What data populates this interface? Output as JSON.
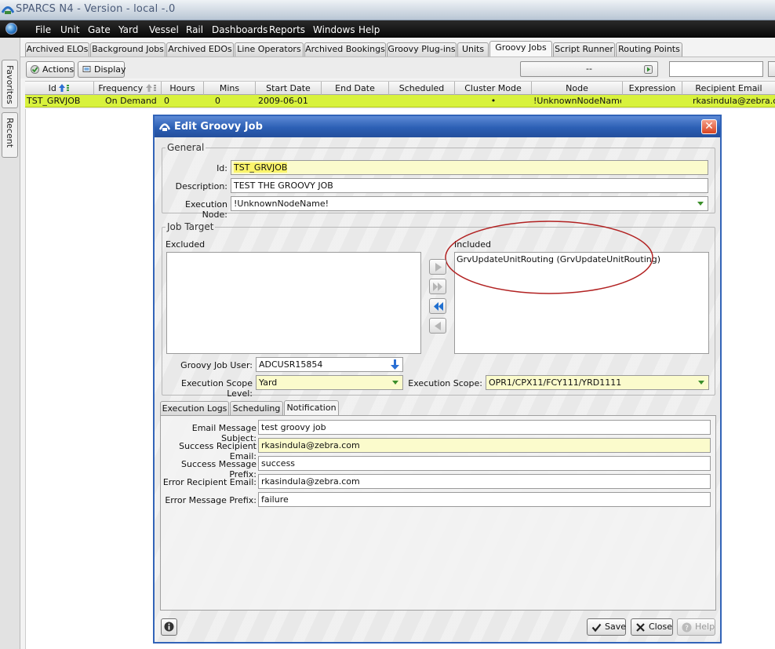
{
  "window": {
    "title": "SPARCS N4 - Version - local -.0"
  },
  "menu": [
    {
      "label": "File"
    },
    {
      "label": "Unit"
    },
    {
      "label": "Gate"
    },
    {
      "label": "Yard"
    },
    {
      "label": "Vessel"
    },
    {
      "label": "Rail"
    },
    {
      "label": "Dashboards"
    },
    {
      "label": "Reports"
    },
    {
      "label": "Windows"
    },
    {
      "label": "Help"
    }
  ],
  "dock": {
    "favorites": "Favorites",
    "recent": "Recent"
  },
  "tabs": [
    {
      "label": "Archived ELOs"
    },
    {
      "label": "Background Jobs"
    },
    {
      "label": "Archived EDOs"
    },
    {
      "label": "Line Operators"
    },
    {
      "label": "Archived Bookings"
    },
    {
      "label": "Groovy Plug-ins"
    },
    {
      "label": "Units"
    },
    {
      "label": "Groovy Jobs"
    },
    {
      "label": "Script Runner"
    },
    {
      "label": "Routing Points"
    }
  ],
  "toolbar": {
    "actions": "Actions",
    "display": "Display",
    "combo_value": "--"
  },
  "grid": {
    "columns": [
      "Id",
      "Frequency",
      "Hours",
      "Mins",
      "Start Date",
      "End Date",
      "Scheduled",
      "Cluster Mode",
      "Node",
      "Expression",
      "Recipient Email"
    ],
    "row": {
      "id": "TST_GRVJOB",
      "frequency": "On Demand",
      "hours": "0",
      "mins": "0",
      "start_date": "2009-06-01",
      "end_date": "",
      "scheduled": "",
      "cluster_mode": "•",
      "node": "!UnknownNodeName!",
      "expression": "",
      "recipient_email": "rkasindula@zebra.com"
    }
  },
  "dialog": {
    "title": "Edit Groovy Job",
    "general": {
      "legend": "General",
      "id_label": "Id:",
      "id_value": "TST_GRVJOB",
      "description_label": "Description:",
      "description_value": "TEST THE GROOVY JOB",
      "node_label": "Execution Node:",
      "node_value": "!UnknownNodeName!"
    },
    "job_target": {
      "legend": "Job Target",
      "excluded_label": "Excluded",
      "included_label": "Included",
      "included_items": [
        "GrvUpdateUnitRouting (GrvUpdateUnitRouting)"
      ],
      "user_label": "Groovy Job User:",
      "user_value": "ADCUSR15854",
      "scope_level_label": "Execution Scope Level:",
      "scope_level_value": "Yard",
      "scope_label": "Execution Scope:",
      "scope_value": "OPR1/CPX11/FCY111/YRD1111"
    },
    "tabs": [
      {
        "label": "Execution Logs"
      },
      {
        "label": "Scheduling"
      },
      {
        "label": "Notification"
      }
    ],
    "notification": {
      "subject_label": "Email Message Subject:",
      "subject_value": "test groovy job",
      "success_email_label": "Success Recipient Email:",
      "success_email_value": "rkasindula@zebra.com",
      "success_prefix_label": "Success Message Prefix:",
      "success_prefix_value": "success",
      "error_email_label": "Error Recipient Email:",
      "error_email_value": "rkasindula@zebra.com",
      "error_prefix_label": "Error Message Prefix:",
      "error_prefix_value": "failure"
    },
    "buttons": {
      "save": "Save",
      "close": "Close",
      "help": "Help"
    }
  },
  "colors": {
    "selected_row": "#d8f23c",
    "field_highlight": "#fbfbcc",
    "dialog_border": "#3264b8",
    "annotation": "#b22222"
  }
}
